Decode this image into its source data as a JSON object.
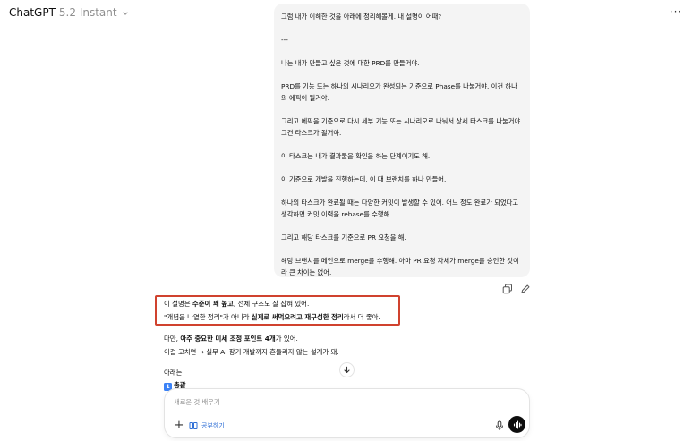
{
  "header": {
    "app_name": "ChatGPT",
    "model_version": "5.2 Instant",
    "more_label": "···"
  },
  "user_message": {
    "paragraphs": [
      "그럼 내가 이해한 것을 아래에 정리해볼게. 내 설명이 어때?",
      "---",
      "나는 내가 만들고 싶은 것에 대한 PRD를 만들거야.",
      "PRD를 기능 또는 하나의 시나리오가 완성되는 기준으로 Phase를 나눌거야. 이건 하나의 에픽이 될거야.",
      "그리고 에픽을 기준으로 다시 세부 기능 또는 시나리오로 나눠서 상세 타스크를 나눌거야. 그건 타스크가 될거야.",
      "이 타스크는 내가 결과물을 확인을 하는 단계이기도 해.",
      "이 기준으로 개발을 진행하는데, 이 때 브랜치를 하나 만들어.",
      "하나의 타스크가 완료될 때는 다양한 커밋이 발생할 수 있어. 어느 정도 완료가 되었다고 생각하면 커밋 이력을 rebase를 수행해.",
      "그리고 해당 타스크를 기준으로 PR 요청을 해.",
      "해당 브랜치를 메인으로 merge를 수행해. 아마 PR 요청 자체가 merge를 승인한 것이라 큰 차이는 없어."
    ]
  },
  "assistant_message": {
    "line1": {
      "pre": "이 설명은 ",
      "bold": "수준이 꽤 높고",
      "post": ", 전체 구조도 잘 잡혀 있어."
    },
    "line2": {
      "pre": "\"개념을 나열한 정리\"가 아니라 ",
      "bold": "실제로 써먹으려고 재구성한 정리",
      "post": "라서 더 좋아."
    },
    "line3": {
      "pre": "다만, ",
      "bold": "아주 중요한 미세 조정 포인트 4개",
      "post": "가 있어."
    },
    "line4": "이걸 고치면 → 실무·AI·장기 개발까지 흔들리지 않는 설계가 돼.",
    "line5": "아래는",
    "line6_badge": "1",
    "line6_text": "총괄"
  },
  "composer": {
    "placeholder": "새로운 것 배우기",
    "study_label": "공부하기"
  },
  "colors": {
    "highlight_border": "#d0422e",
    "study_accent": "#2f6fd6",
    "bubble_bg": "#f4f4f4"
  },
  "icons": [
    "chevron-down-icon",
    "more-icon",
    "copy-icon",
    "edit-icon",
    "arrow-down-icon",
    "plus-icon",
    "book-icon",
    "mic-icon",
    "voice-wave-icon"
  ]
}
